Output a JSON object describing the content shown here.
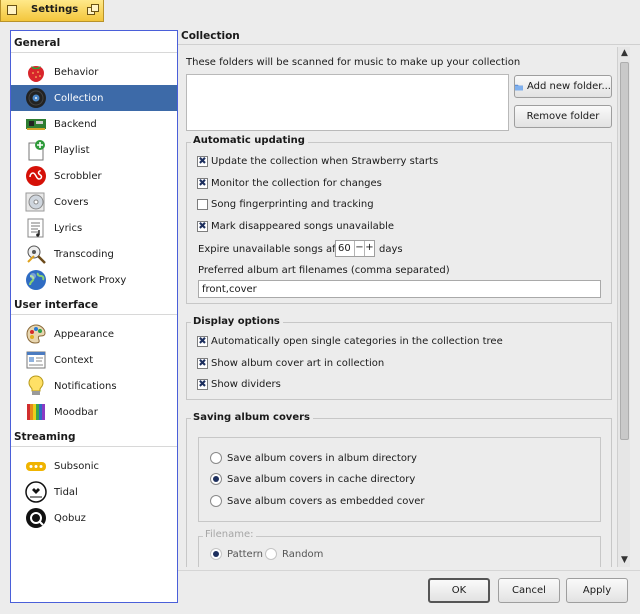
{
  "window": {
    "title": "Settings"
  },
  "sidebar": {
    "groups": [
      {
        "label": "General",
        "items": [
          {
            "label": "Behavior",
            "icon": "strawberry-icon"
          },
          {
            "label": "Collection",
            "icon": "vinyl-record-icon",
            "selected": true
          },
          {
            "label": "Backend",
            "icon": "circuit-board-icon"
          },
          {
            "label": "Playlist",
            "icon": "playlist-add-icon"
          },
          {
            "label": "Scrobbler",
            "icon": "lastfm-icon"
          },
          {
            "label": "Covers",
            "icon": "cd-cover-icon"
          },
          {
            "label": "Lyrics",
            "icon": "lyrics-sheet-icon"
          },
          {
            "label": "Transcoding",
            "icon": "transcoding-icon"
          },
          {
            "label": "Network Proxy",
            "icon": "globe-icon"
          }
        ]
      },
      {
        "label": "User interface",
        "items": [
          {
            "label": "Appearance",
            "icon": "palette-icon"
          },
          {
            "label": "Context",
            "icon": "context-window-icon"
          },
          {
            "label": "Notifications",
            "icon": "lightbulb-icon"
          },
          {
            "label": "Moodbar",
            "icon": "moodbar-icon"
          }
        ]
      },
      {
        "label": "Streaming",
        "items": [
          {
            "label": "Subsonic",
            "icon": "subsonic-icon"
          },
          {
            "label": "Tidal",
            "icon": "tidal-icon"
          },
          {
            "label": "Qobuz",
            "icon": "qobuz-icon"
          }
        ]
      }
    ]
  },
  "page": {
    "title": "Collection",
    "folders_label": "These folders will be scanned for music to make up your collection",
    "add_folder_label": "Add new folder...",
    "remove_folder_label": "Remove folder"
  },
  "auto_update": {
    "title": "Automatic updating",
    "update_on_start": {
      "label": "Update the collection when Strawberry starts",
      "checked": true
    },
    "monitor_changes": {
      "label": "Monitor the collection for changes",
      "checked": true
    },
    "fingerprinting": {
      "label": "Song fingerprinting and tracking",
      "checked": false
    },
    "mark_unavailable": {
      "label": "Mark disappeared songs unavailable",
      "checked": true
    },
    "expire_label": "Expire unavailable songs after",
    "expire_value": "60",
    "expire_unit": "days",
    "album_art_label": "Preferred album art filenames (comma separated)",
    "album_art_value": "front,cover"
  },
  "display": {
    "title": "Display options",
    "open_single": {
      "label": "Automatically open single categories in the collection tree",
      "checked": true
    },
    "show_cover_art": {
      "label": "Show album cover art in collection",
      "checked": true
    },
    "show_dividers": {
      "label": "Show dividers",
      "checked": true
    }
  },
  "covers": {
    "title": "Saving album covers",
    "options": [
      {
        "label": "Save album covers in album directory",
        "selected": false
      },
      {
        "label": "Save album covers in cache directory",
        "selected": true
      },
      {
        "label": "Save album covers as embedded cover",
        "selected": false
      }
    ],
    "filename_title": "Filename:",
    "filename_options": [
      {
        "label": "Pattern",
        "selected": true
      },
      {
        "label": "Random",
        "selected": false
      }
    ]
  },
  "buttons": {
    "ok": "OK",
    "cancel": "Cancel",
    "apply": "Apply"
  },
  "check_glyph": "✖",
  "colors": {
    "selection": "#3d6aa8",
    "title_tab": "#f3c63c",
    "sidebar_border": "#4a5fd9"
  }
}
